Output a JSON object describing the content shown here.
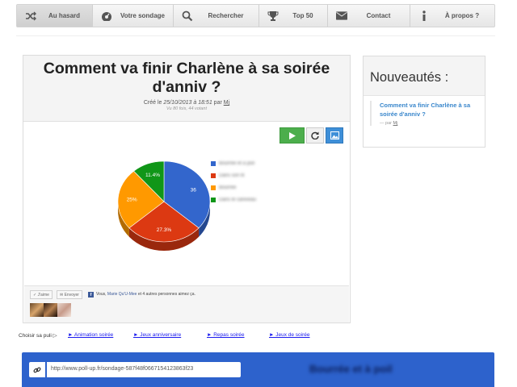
{
  "nav": {
    "items": [
      {
        "label": "Au hasard",
        "icon": "shuffle-icon"
      },
      {
        "label": "Votre sondage",
        "icon": "dashboard-icon"
      },
      {
        "label": "Rechercher",
        "icon": "search-icon"
      },
      {
        "label": "Top 50",
        "icon": "trophy-icon"
      },
      {
        "label": "Contact",
        "icon": "envelope-icon"
      },
      {
        "label": "À propos ?",
        "icon": "info-icon"
      }
    ]
  },
  "poll": {
    "title": "Comment va finir Charlène à sa soirée d'anniv ?",
    "created_prefix": "Créé le",
    "created_date": "25/10/2013 à 18:51",
    "by_word": "par",
    "author": "Mj",
    "stats": "Vu 80 fois, 44 votant",
    "chart_slices": [
      {
        "label": "Bourrée et à poil",
        "percent": 36.4,
        "display": "36",
        "color": "#3366cc"
      },
      {
        "label": "Dans son lit",
        "percent": 27.3,
        "display": "27.3%",
        "color": "#dc3912"
      },
      {
        "label": "Bourrée",
        "percent": 25,
        "display": "25%",
        "color": "#ff9900"
      },
      {
        "label": "Dans le caniveau",
        "percent": 11.4,
        "display": "11.4%",
        "color": "#109618"
      }
    ]
  },
  "social": {
    "like_label": "J'aime",
    "send_label": "Envoyer",
    "fb_prefix": "Vous,",
    "fb_name": "Marie Qu'U-Mee",
    "fb_suffix": "et 4 autres personnes aimez ça."
  },
  "sidebar": {
    "title": "Nouveautés :",
    "item_title": "Comment va finir Charlène à sa soirée d'anniv ?",
    "item_by": "— par",
    "item_author": "Mj"
  },
  "suggestions": {
    "label": "Choisir sa puli ▷",
    "links": [
      "► Animation soirée",
      "► Jeux anniversaire",
      "► Repas soirée",
      "► Jeux de soirée"
    ]
  },
  "share": {
    "url": "http://www.poll-up.fr/sondage-587f48f0667154123863f23",
    "title": "Bourrée et à poil"
  }
}
